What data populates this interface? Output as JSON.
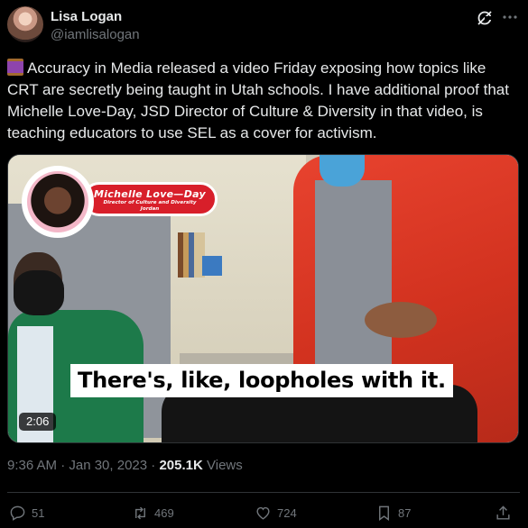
{
  "author": {
    "name": "Lisa Logan",
    "handle": "@iamlisalogan"
  },
  "icons": {
    "avatar": "profile-photo",
    "grok": "grok-icon",
    "more": "more-icon",
    "thread": "spool-of-thread-emoji"
  },
  "tweet": {
    "text": "Accuracy in Media released a video Friday exposing how topics like CRT are secretly being taught in Utah schools. I have additional proof that Michelle Love-Day, JSD Director of Culture & Diversity in that video, is teaching educators to use SEL as a cover for activism."
  },
  "video": {
    "lower_third_name": "Michelle Love—Day",
    "lower_third_title": "Director of Culture and Diversity",
    "lower_third_org": "Jordan",
    "caption": "There's, like, loopholes with it.",
    "duration": "2:06"
  },
  "meta": {
    "timestamp": "9:36 AM · Jan 30, 2023",
    "separator": "·",
    "views_count": "205.1K",
    "views_label": "Views"
  },
  "actions": {
    "replies": "51",
    "reposts": "469",
    "likes": "724",
    "bookmarks": "87"
  },
  "colors": {
    "background": "#000000",
    "text": "#e7e9ea",
    "secondary": "#71767b",
    "divider": "#2f3336",
    "nameplate": "#d81f2a"
  }
}
